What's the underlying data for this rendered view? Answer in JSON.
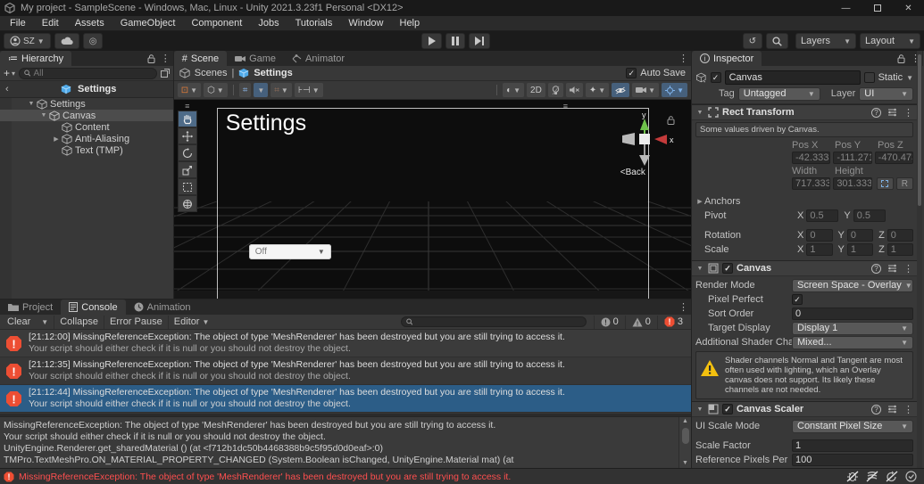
{
  "window": {
    "title": "My project - SampleScene - Windows, Mac, Linux - Unity 2021.3.23f1 Personal <DX12>"
  },
  "menu": {
    "items": [
      "File",
      "Edit",
      "Assets",
      "GameObject",
      "Component",
      "Jobs",
      "Tutorials",
      "Window",
      "Help"
    ]
  },
  "toolbar": {
    "account": "SZ",
    "layers": "Layers",
    "layout": "Layout"
  },
  "hierarchy": {
    "tab": "Hierarchy",
    "search_placeholder": "All",
    "prefab_title": "Settings",
    "items": [
      {
        "label": "Settings"
      },
      {
        "label": "Canvas"
      },
      {
        "label": "Content"
      },
      {
        "label": "Anti-Aliasing"
      },
      {
        "label": "Text (TMP)"
      }
    ]
  },
  "scene": {
    "tabs": {
      "scene": "Scene",
      "game": "Game",
      "animator": "Animator"
    },
    "breadcrumb": {
      "scenes": "Scenes",
      "current": "Settings"
    },
    "auto_save": "Auto Save",
    "toolbar": {
      "mode_2d": "2D"
    },
    "viewport": {
      "title": "Settings",
      "dropdown_value": "Off",
      "back": "<Back",
      "axis_x": "x",
      "axis_y": "y"
    }
  },
  "inspector": {
    "tab": "Inspector",
    "header": {
      "name": "Canvas",
      "static": "Static",
      "tag_label": "Tag",
      "tag": "Untagged",
      "layer_label": "Layer",
      "layer": "UI"
    },
    "rect_transform": {
      "title": "Rect Transform",
      "info": "Some values driven by Canvas.",
      "pos_x_label": "Pos X",
      "pos_y_label": "Pos Y",
      "pos_z_label": "Pos Z",
      "pos_x": "-42.3333",
      "pos_y": "-111.2713",
      "pos_z": "-470.4733",
      "width_label": "Width",
      "height_label": "Height",
      "width": "717.3333",
      "height": "301.333",
      "r_button": "R",
      "anchors": "Anchors",
      "pivot_label": "Pivot",
      "pivot_x": "0.5",
      "pivot_y": "0.5",
      "rotation_label": "Rotation",
      "rot_x": "0",
      "rot_y": "0",
      "rot_z": "0",
      "scale_label": "Scale",
      "scale_x": "1",
      "scale_y": "1",
      "scale_z": "1",
      "x": "X",
      "y": "Y",
      "z": "Z"
    },
    "canvas": {
      "title": "Canvas",
      "render_mode_label": "Render Mode",
      "render_mode": "Screen Space - Overlay",
      "pixel_perfect_label": "Pixel Perfect",
      "sort_order_label": "Sort Order",
      "sort_order": "0",
      "target_display_label": "Target Display",
      "target_display": "Display 1",
      "shader_channels_label": "Additional Shader Channels",
      "shader_channels": "Mixed...",
      "warning": "Shader channels Normal and Tangent are most often used with lighting, which an Overlay canvas does not support. Its likely these channels are not needed."
    },
    "canvas_scaler": {
      "title": "Canvas Scaler",
      "ui_scale_mode_label": "UI Scale Mode",
      "ui_scale_mode": "Constant Pixel Size",
      "scale_factor_label": "Scale Factor",
      "scale_factor": "1",
      "reference_label": "Reference Pixels Per",
      "reference": "100"
    }
  },
  "console": {
    "tabs": {
      "project": "Project",
      "console": "Console",
      "animation": "Animation"
    },
    "toolbar": {
      "clear": "Clear",
      "collapse": "Collapse",
      "error_pause": "Error Pause",
      "editor": "Editor"
    },
    "counts": {
      "info": "0",
      "warning": "0",
      "error": "3"
    },
    "entries": [
      {
        "line1": "[21:12:00] MissingReferenceException: The object of type 'MeshRenderer' has been destroyed but you are still trying to access it.",
        "line2": "Your script should either check if it is null or you should not destroy the object."
      },
      {
        "line1": "[21:12:35] MissingReferenceException: The object of type 'MeshRenderer' has been destroyed but you are still trying to access it.",
        "line2": "Your script should either check if it is null or you should not destroy the object."
      },
      {
        "line1": "[21:12:44] MissingReferenceException: The object of type 'MeshRenderer' has been destroyed but you are still trying to access it.",
        "line2": "Your script should either check if it is null or you should not destroy the object."
      }
    ],
    "detail_lines": [
      "MissingReferenceException: The object of type 'MeshRenderer' has been destroyed but you are still trying to access it.",
      "Your script should either check if it is null or you should not destroy the object.",
      "UnityEngine.Renderer.get_sharedMaterial () (at <f712b1dc50b4468388b9c5f95d0d0eaf>:0)",
      "TMPro.TextMeshPro.ON_MATERIAL_PROPERTY_CHANGED (System.Boolean isChanged, UnityEngine.Material mat) (at"
    ]
  },
  "status": {
    "error": "MissingReferenceException: The object of type 'MeshRenderer' has been destroyed but you are still trying to access it."
  }
}
